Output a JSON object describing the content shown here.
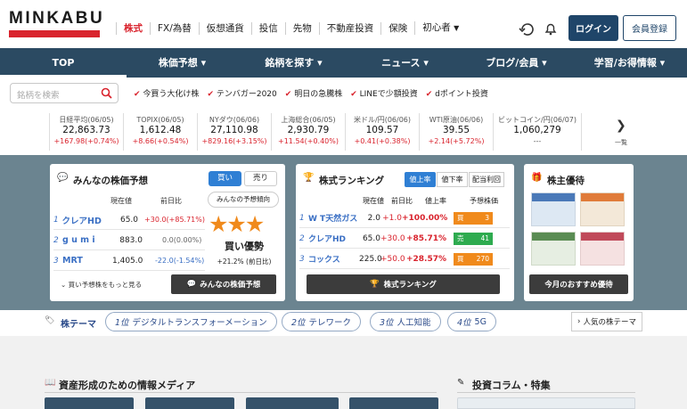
{
  "logo": {
    "text": "MINKABU"
  },
  "topnav": [
    "株式",
    "FX/為替",
    "仮想通貨",
    "投信",
    "先物",
    "不動産投資",
    "保険",
    "初心者"
  ],
  "header": {
    "login": "ログイン",
    "register": "会員登録"
  },
  "mainnav": [
    "TOP",
    "株価予想",
    "銘柄を探す",
    "ニュース",
    "ブログ/会員",
    "学習/お得情報"
  ],
  "search": {
    "placeholder": "銘柄を検索"
  },
  "tags": [
    "今買う大化け株",
    "テンバガー2020",
    "明日の急騰株",
    "LINEで少額投資",
    "dポイント投資"
  ],
  "ticker": [
    {
      "name": "日経平均(06/05)",
      "value": "22,863.73",
      "change": "+167.98(+0.74%)"
    },
    {
      "name": "TOPIX(06/05)",
      "value": "1,612.48",
      "change": "+8.66(+0.54%)"
    },
    {
      "name": "NYダウ(06/06)",
      "value": "27,110.98",
      "change": "+829.16(+3.15%)"
    },
    {
      "name": "上海総合(06/05)",
      "value": "2,930.79",
      "change": "+11.54(+0.40%)"
    },
    {
      "name": "米ドル/円(06/06)",
      "value": "109.57",
      "change": "+0.41(+0.38%)"
    },
    {
      "name": "WTI原油(06/06)",
      "value": "39.55",
      "change": "+2.14(+5.72%)"
    },
    {
      "name": "ビットコイン/円(06/07)",
      "value": "1,060,279",
      "change": "---"
    }
  ],
  "ticker_more": "一覧",
  "forecast": {
    "title": "みんなの株価予想",
    "tab_buy": "買い",
    "tab_sell": "売り",
    "col_price": "現在値",
    "col_change": "前日比",
    "rows": [
      {
        "rank": "1",
        "name": "クレアHD",
        "price": "65.0",
        "change": "+30.0(+85.71%)"
      },
      {
        "rank": "2",
        "name": "g u m i",
        "price": "883.0",
        "change": "0.0(0.00%)"
      },
      {
        "rank": "3",
        "name": "MRT",
        "price": "1,405.0",
        "change": "-22.0(-1.54%)"
      }
    ],
    "trend_label": "みんなの予想傾向",
    "verdict": "買い優勢",
    "verdict_pct": "+21.2% (前日比)",
    "more": "買い予想株をもっと見る",
    "button": "みんなの株価予想"
  },
  "ranking": {
    "title": "株式ランキング",
    "tabs": [
      "値上率",
      "値下率",
      "配当利回"
    ],
    "col_price": "現在値",
    "col_change": "前日比",
    "col_rate": "値上率",
    "col_forecast": "予想株価",
    "rows": [
      {
        "rank": "1",
        "name": "W T天然ガス",
        "price": "2.0",
        "change": "+1.0",
        "rate": "+100.00%",
        "tag": "買",
        "count": "3"
      },
      {
        "rank": "2",
        "name": "クレアHD",
        "price": "65.0",
        "change": "+30.0",
        "rate": "+85.71%",
        "tag": "売",
        "count": "41"
      },
      {
        "rank": "3",
        "name": "コックス",
        "price": "225.0",
        "change": "+50.0",
        "rate": "+28.57%",
        "tag": "買",
        "count": "270"
      }
    ],
    "button": "株式ランキング"
  },
  "yutai": {
    "title": "株主優待",
    "button": "今月のおすすめ優待"
  },
  "theme": {
    "label": "株テーマ",
    "items": [
      {
        "rank": "1位",
        "name": "デジタルトランスフォーメーション"
      },
      {
        "rank": "2位",
        "name": "テレワーク"
      },
      {
        "rank": "3位",
        "name": "人工知能"
      },
      {
        "rank": "4位",
        "name": "5G"
      }
    ],
    "popular": "人気の株テーマ"
  },
  "media": {
    "title": "資産形成のための情報メディア"
  },
  "column": {
    "title": "投資コラム・特集"
  },
  "colors": {
    "brand_red": "#d9232d",
    "nav_blue": "#2b4a62",
    "accent_blue": "#1f4569"
  }
}
